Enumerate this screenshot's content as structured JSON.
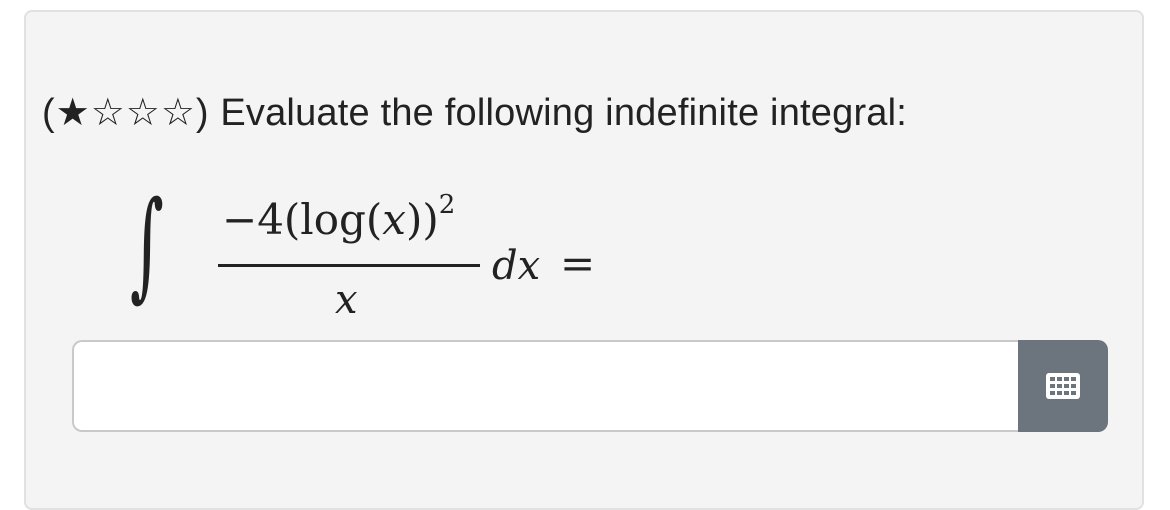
{
  "question": {
    "difficulty_stars": "(★☆☆☆)",
    "prompt": "Evaluate the following indefinite integral:"
  },
  "math": {
    "integral_sign": "∫",
    "numerator": "−4(log(𝑥))",
    "numerator_exponent": "2",
    "denominator": "x",
    "differential": "dx",
    "equals": "="
  },
  "answer": {
    "value": "",
    "placeholder": ""
  },
  "icons": {
    "keypad": "keyboard-grid-icon"
  },
  "colors": {
    "card_background": "#f4f4f4",
    "keypad_button": "#6c757d"
  }
}
